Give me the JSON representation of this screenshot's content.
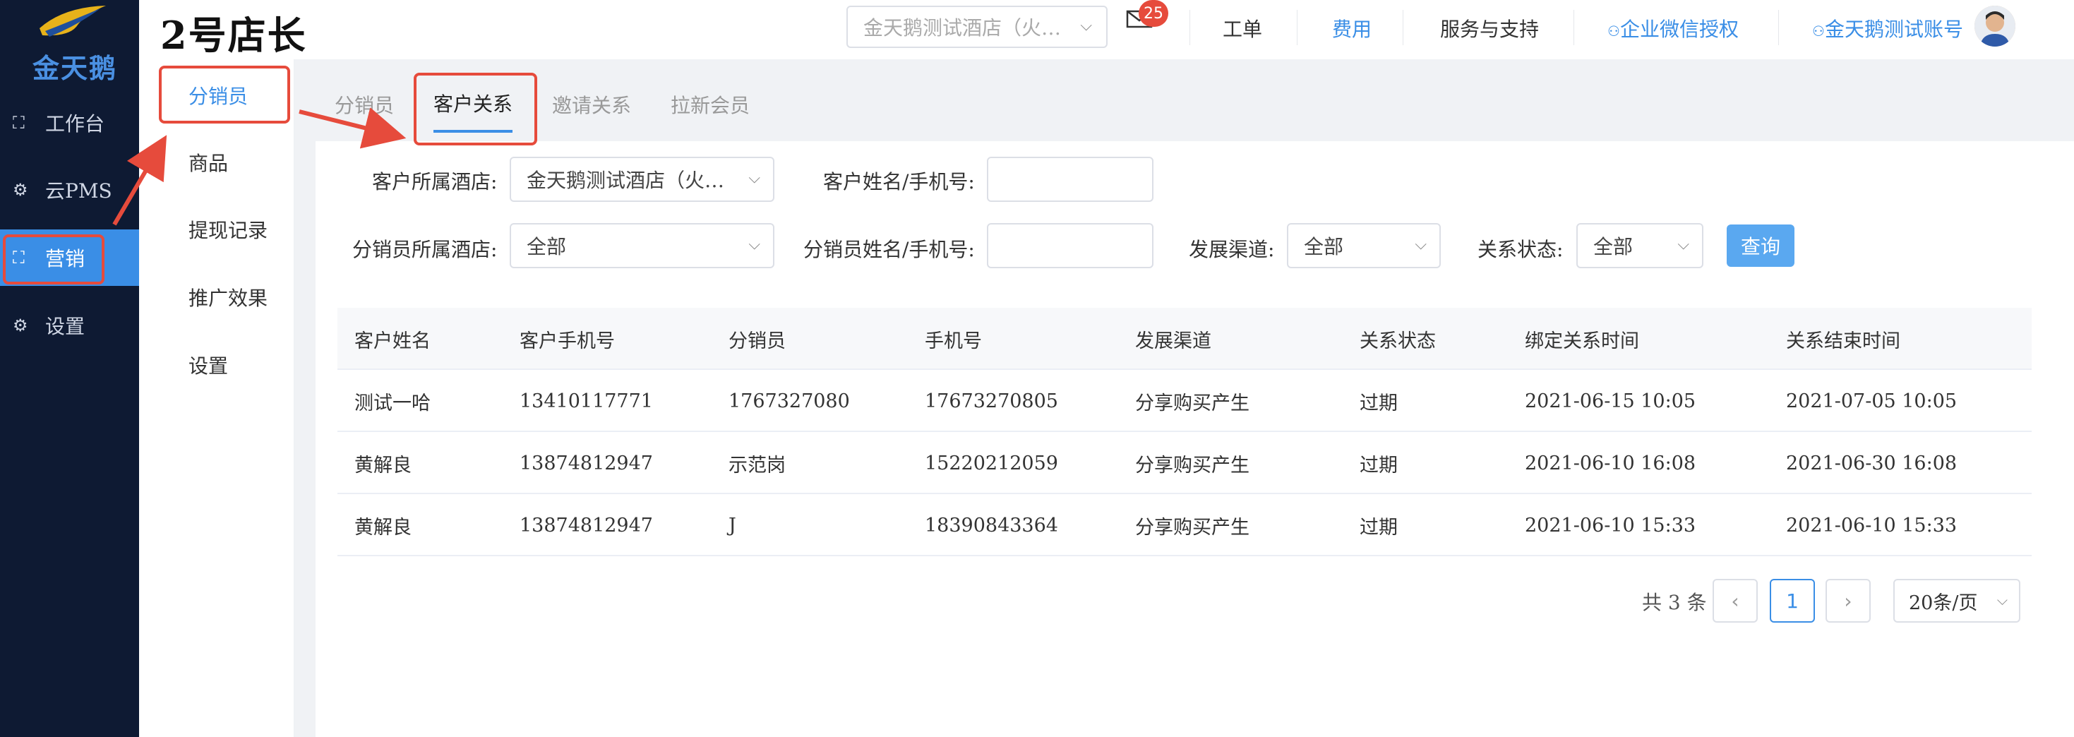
{
  "brand": {
    "logo_text": "金天鹅",
    "app_title": "2号店长"
  },
  "leftnav": {
    "items": [
      {
        "label": "工作台",
        "icon": "workspace-icon"
      },
      {
        "label": "云PMS",
        "icon": "gear-icon"
      },
      {
        "label": "营销",
        "icon": "marketing-icon"
      },
      {
        "label": "设置",
        "icon": "gear-icon"
      }
    ]
  },
  "subnav": {
    "items": [
      {
        "label": "分销员"
      },
      {
        "label": "商品"
      },
      {
        "label": "提现记录"
      },
      {
        "label": "推广效果"
      },
      {
        "label": "设置"
      }
    ]
  },
  "header": {
    "hotel_select": "金天鹅测试酒店（火…",
    "mail_badge": "25",
    "links": {
      "ticket": "工单",
      "fee": "费用",
      "service": "服务与支持",
      "wechat_auth": "企业微信授权",
      "account": "金天鹅测试账号"
    }
  },
  "tabs": [
    {
      "label": "分销员"
    },
    {
      "label": "客户关系"
    },
    {
      "label": "邀请关系"
    },
    {
      "label": "拉新会员"
    }
  ],
  "filters": {
    "customer_hotel_label": "客户所属酒店:",
    "customer_hotel_value": "金天鹅测试酒店（火…",
    "customer_name_label": "客户姓名/手机号:",
    "customer_name_value": "",
    "distributor_hotel_label": "分销员所属酒店:",
    "distributor_hotel_value": "全部",
    "distributor_name_label": "分销员姓名/手机号:",
    "distributor_name_value": "",
    "channel_label": "发展渠道:",
    "channel_value": "全部",
    "status_label": "关系状态:",
    "status_value": "全部",
    "query_button": "查询"
  },
  "table": {
    "columns": [
      "客户姓名",
      "客户手机号",
      "分销员",
      "手机号",
      "发展渠道",
      "关系状态",
      "绑定关系时间",
      "关系结束时间"
    ],
    "rows": [
      [
        "测试一哈",
        "13410117771",
        "1767327080",
        "17673270805",
        "分享购买产生",
        "过期",
        "2021-06-15 10:05",
        "2021-07-05 10:05"
      ],
      [
        "黄解良",
        "13874812947",
        "示范岗",
        "15220212059",
        "分享购买产生",
        "过期",
        "2021-06-10 16:08",
        "2021-06-30 16:08"
      ],
      [
        "黄解良",
        "13874812947",
        "J",
        "18390843364",
        "分享购买产生",
        "过期",
        "2021-06-10 15:33",
        "2021-06-10 15:33"
      ]
    ]
  },
  "pager": {
    "total": "共 3 条",
    "current_page": "1",
    "page_size": "20条/页"
  },
  "colors": {
    "accent": "#3a8ee6",
    "nav_bg": "#0e1a33",
    "highlight": "#e64b3c"
  }
}
